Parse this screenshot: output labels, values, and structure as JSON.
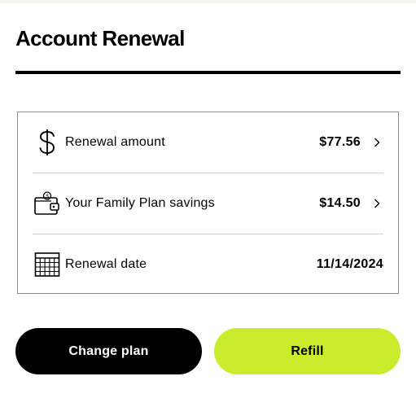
{
  "page": {
    "title": "Account Renewal"
  },
  "summary": {
    "rows": [
      {
        "icon": "dollar-sign-icon",
        "label": "Renewal amount",
        "value": "$77.56",
        "has_chevron": true
      },
      {
        "icon": "wallet-icon",
        "label": "Your Family Plan savings",
        "value": "$14.50",
        "has_chevron": true
      },
      {
        "icon": "calendar-icon",
        "label": "Renewal date",
        "value": "11/14/2024",
        "has_chevron": false
      }
    ]
  },
  "actions": {
    "change_plan_label": "Change plan",
    "refill_label": "Refill"
  },
  "colors": {
    "accent": "#c9ec2c",
    "primary_button": "#000000",
    "border": "#8c8c8c",
    "divider": "#d2d2d2"
  }
}
